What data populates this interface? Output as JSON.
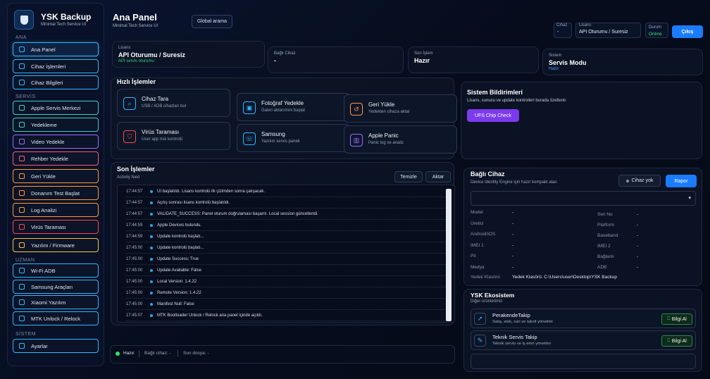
{
  "app": {
    "title": "YSK Backup",
    "subtitle": "Minimal Tech Service UI"
  },
  "sidebar": {
    "sections": [
      "ANA",
      "SERVİS",
      "UZMAN",
      "SİSTEM"
    ],
    "items": [
      {
        "label": "Ana Panel",
        "icon": "home-icon",
        "color": "#33b6ff",
        "active": true
      },
      {
        "label": "Cihaz İşlemleri",
        "icon": "search-icon",
        "color": "#33b6ff"
      },
      {
        "label": "Cihaz Bilgileri",
        "icon": "info-icon",
        "color": "#33b6ff"
      },
      {
        "label": "Apple Servis Merkezi",
        "icon": "apple-icon",
        "color": "#3ad1c7"
      },
      {
        "label": "Yedekleme",
        "icon": "cloud-icon",
        "color": "#3ad1c7"
      },
      {
        "label": "Video Yedekle",
        "icon": "video-icon",
        "color": "#9a6cff"
      },
      {
        "label": "Rehber Yedekle",
        "icon": "contacts-icon",
        "color": "#ff5a7a"
      },
      {
        "label": "Geri Yükle",
        "icon": "restore-icon",
        "color": "#ff9a3a"
      },
      {
        "label": "Donanım Test Başlat",
        "icon": "chip-icon",
        "color": "#ff9a3a"
      },
      {
        "label": "Log Analizi",
        "icon": "log-icon",
        "color": "#ff9a3a"
      },
      {
        "label": "Virüs Taraması",
        "icon": "shield-icon",
        "color": "#ff4a4a"
      },
      {
        "label": "Yazılım / Firmware",
        "icon": "firmware-icon",
        "color": "#ffc23a"
      },
      {
        "label": "Wi-Fi ADB",
        "icon": "wifi-icon",
        "color": "#33b6ff"
      },
      {
        "label": "Samsung Araçları",
        "icon": "tools-icon",
        "color": "#33b6ff"
      },
      {
        "label": "Xiaomi Yazılım",
        "icon": "phone-icon",
        "color": "#33b6ff"
      },
      {
        "label": "MTK Unlock / Relock",
        "icon": "unlock-icon",
        "color": "#33b6ff"
      },
      {
        "label": "Ayarlar",
        "icon": "gear-icon",
        "color": "#33b6ff"
      }
    ]
  },
  "header": {
    "title": "Ana Panel",
    "subtitle": "Minimal Tech Service UI",
    "search_label": "Global arama",
    "device_label": "Cihaz",
    "device_value": "-",
    "license_label": "Lisans",
    "license_value": "API Oturumu / Suresiz",
    "status_label": "Durum",
    "status_value": "Online",
    "logout": "Çıkış"
  },
  "stats": [
    {
      "label": "Lisans",
      "value": "API Oturumu / Suresiz",
      "sub": "API servis oturumu"
    },
    {
      "label": "Bağlı Cihaz",
      "value": "-",
      "sub": ""
    },
    {
      "label": "Son İşlem",
      "value": "Hazır",
      "sub": ""
    },
    {
      "label": "Sistem",
      "value": "Servis Modu",
      "sub": "Hazır"
    }
  ],
  "quick": {
    "title": "Hızlı İşlemler",
    "cards": [
      {
        "title": "Cihaz Tara",
        "sub": "USB / ADB cihazları bul",
        "icon": "search-icon",
        "color": "#33b6ff"
      },
      {
        "title": "Fotoğraf Yedekle",
        "sub": "Galeri aktarımını başlat",
        "icon": "photo-icon",
        "color": "#33b6ff"
      },
      {
        "title": "Geri Yükle",
        "sub": "Yedekten cihaza aktar",
        "icon": "restore-icon",
        "color": "#ff9a3a"
      },
      {
        "title": "Virüs Taraması",
        "sub": "User app risk kontrolü",
        "icon": "shield-icon",
        "color": "#ff4a4a"
      },
      {
        "title": "Samsung",
        "sub": "Yazılım servis paneli",
        "icon": "phone-icon",
        "color": "#33b6ff"
      },
      {
        "title": "Apple Panic",
        "sub": "Panic log ve analiz",
        "icon": "chart-icon",
        "color": "#9a6cff"
      }
    ]
  },
  "notify": {
    "title": "Sistem Bildirimleri",
    "sub": "Lisans, sunucu ve update kontrolleri burada özetlenir.",
    "button": "UFS Chip Check"
  },
  "activity": {
    "title": "Son İşlemler",
    "sub": "Activity feed",
    "clear": "Temizle",
    "export": "Aktar",
    "rows": [
      {
        "time": "17:44:57",
        "text": "UI başlatıldı. Lisans kontrolü ilk çizimden sonra çalışacak."
      },
      {
        "time": "17:44:57",
        "text": "Açılış sonrası lisans kontrolü başlatıldı."
      },
      {
        "time": "17:44:57",
        "text": "VALIDATE_SUCCESS: Panel oturum doğrulaması başarılı. Local session güncellendi."
      },
      {
        "time": "17:44:59",
        "text": "Apple Devices bulundu."
      },
      {
        "time": "17:44:59",
        "text": "Update kontrolü başlatı..."
      },
      {
        "time": "17:45:00",
        "text": "Update kontrolü başlatı..."
      },
      {
        "time": "17:45:00",
        "text": "Update Success: True"
      },
      {
        "time": "17:45:00",
        "text": "Update Available: False"
      },
      {
        "time": "17:45:00",
        "text": "Local Version: 1.4.22"
      },
      {
        "time": "17:45:00",
        "text": "Remote Version: 1.4.22"
      },
      {
        "time": "17:45:00",
        "text": "Manifest Null: False"
      },
      {
        "time": "17:45:07",
        "text": "MTK Bootloader Unlock / Relock ana panel içinde açıldı."
      }
    ]
  },
  "connected": {
    "title": "Bağlı Cihaz",
    "sub": "Device Identity Engine için hazır kompakt alan",
    "no_device": "Cihaz yok",
    "report": "Rapor",
    "left": [
      [
        "Model",
        "-"
      ],
      [
        "Üretici",
        "-"
      ],
      [
        "Android/iOS",
        "-"
      ],
      [
        "IMEI 1",
        "-"
      ],
      [
        "Pil",
        "-"
      ],
      [
        "Medya",
        "-"
      ]
    ],
    "right": [
      [
        "Seri No",
        "-"
      ],
      [
        "Platform",
        "-"
      ],
      [
        "Baseband",
        "-"
      ],
      [
        "IMEI 2",
        "-"
      ],
      [
        "Bağlantı",
        "-"
      ],
      [
        "ADB",
        "-"
      ]
    ],
    "backup_label": "Yedek Klasörü",
    "backup_value": "Yedek Klasörü: C:\\Users\\user\\Desktop\\YSK Backup"
  },
  "ecosystem": {
    "title": "YSK Ekosistem",
    "sub": "Diğer ürünlerimiz",
    "items": [
      {
        "title": "PerakendeTakip",
        "sub": "Satış, stok, cari ve taksit yönetimi",
        "button": "Bilgi Al"
      },
      {
        "title": "Teknik Servis Takip",
        "sub": "Teknik servis ve iş emri yönetimi",
        "button": "Bilgi Al"
      }
    ]
  },
  "statusbar": {
    "ready": "Hazır",
    "device": "Bağlı cihaz: -",
    "file": "Son dosya: -"
  }
}
